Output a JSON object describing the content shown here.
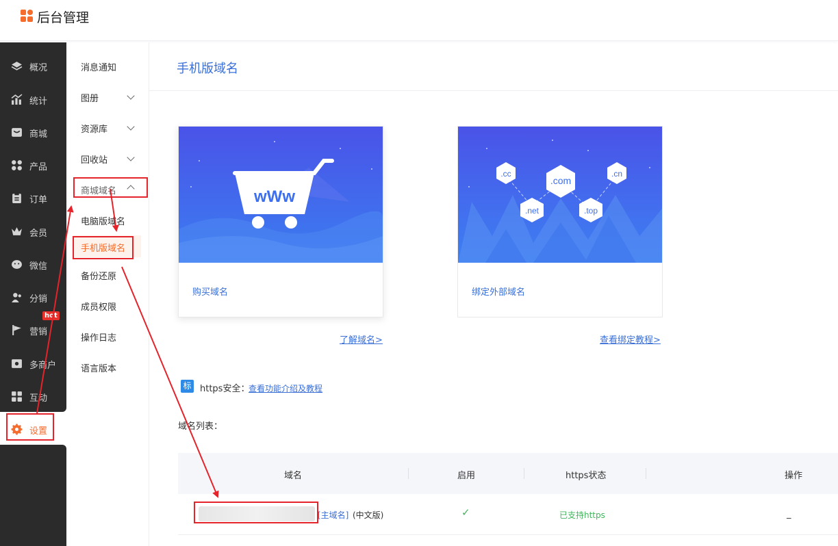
{
  "app": {
    "title": "后台管理"
  },
  "rail": {
    "items": [
      {
        "label": "概况",
        "icon": "layers-icon"
      },
      {
        "label": "统计",
        "icon": "chart-icon"
      },
      {
        "label": "商城",
        "icon": "shop-icon"
      },
      {
        "label": "产品",
        "icon": "product-grid-icon"
      },
      {
        "label": "订单",
        "icon": "order-icon"
      },
      {
        "label": "会员",
        "icon": "crown-icon"
      },
      {
        "label": "微信",
        "icon": "wechat-icon"
      },
      {
        "label": "分销",
        "icon": "users-icon"
      },
      {
        "label": "营销",
        "icon": "flag-icon"
      },
      {
        "label": "多商户",
        "icon": "store-icon"
      },
      {
        "label": "互动",
        "icon": "interact-icon"
      },
      {
        "label": "设置",
        "icon": "gear-icon"
      }
    ],
    "hot_badge": "hot",
    "active": "设置"
  },
  "submenu": {
    "items": [
      {
        "label": "消息通知"
      },
      {
        "label": "图册"
      },
      {
        "label": "资源库"
      },
      {
        "label": "回收站"
      },
      {
        "label": "商城域名"
      },
      {
        "label": "电脑版域名"
      },
      {
        "label": "手机版域名"
      },
      {
        "label": "备份还原"
      },
      {
        "label": "成员权限"
      },
      {
        "label": "操作日志"
      },
      {
        "label": "语言版本"
      }
    ],
    "active": "手机版域名"
  },
  "page": {
    "title": "手机版域名"
  },
  "cards": [
    {
      "label": "购买域名",
      "hero_text": "wWw",
      "link": "了解域名>"
    },
    {
      "label": "绑定外部域名",
      "hero_badges": [
        ".cc",
        ".com",
        ".cn",
        ".net",
        ".top"
      ],
      "link": "查看绑定教程>"
    }
  ],
  "https": {
    "tag": "标",
    "label": "https安全：",
    "link": "查看功能介绍及教程"
  },
  "domain_list": {
    "label": "域名列表：",
    "columns": [
      "域名",
      "启用",
      "https状态",
      "操作"
    ],
    "rows": [
      {
        "domain": "",
        "main_tag": "[主域名]",
        "version": "(中文版)",
        "enabled": "✓",
        "https_status": "已支持https",
        "action": "_"
      }
    ]
  },
  "colors": {
    "accent": "#f56c2d",
    "link": "#3a6fd8",
    "sidebar": "#2b2b2b",
    "annotation": "#e5232a",
    "success": "#42b45c"
  }
}
